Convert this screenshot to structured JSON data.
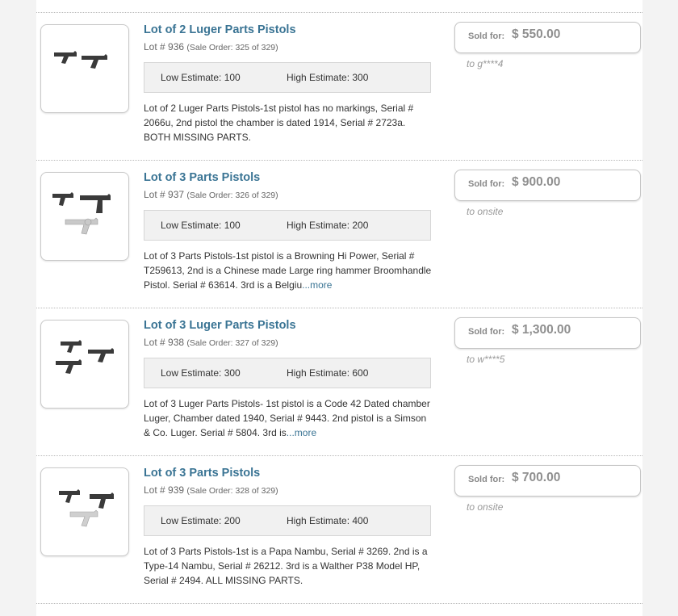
{
  "lots": [
    {
      "title": "Lot of 2 Luger Parts Pistols",
      "lot_number": "Lot # 936",
      "sale_order": "(Sale Order: 325 of 329)",
      "low_estimate": "Low Estimate: 100",
      "high_estimate": "High Estimate: 300",
      "description": "Lot of 2 Luger Parts Pistols-1st pistol has no markings, Serial # 2066u, 2nd pistol the chamber is dated 1914, Serial # 2723a. BOTH MISSING PARTS.",
      "more_link": "",
      "sold_label": "Sold for:",
      "sold_price": "$ 550.00",
      "buyer": "to g****4",
      "image_icon": "two-luger-pistols-image"
    },
    {
      "title": "Lot of 3 Parts Pistols",
      "lot_number": "Lot # 937",
      "sale_order": "(Sale Order: 326 of 329)",
      "low_estimate": "Low Estimate: 100",
      "high_estimate": "High Estimate: 200",
      "description": "Lot of 3 Parts Pistols-1st pistol is a Browning Hi Power, Serial # T259613, 2nd is a Chinese made Large ring hammer Broomhandle Pistol. Serial # 63614. 3rd is a Belgiu",
      "more_link": "...more",
      "sold_label": "Sold for:",
      "sold_price": "$ 900.00",
      "buyer": "to onsite",
      "image_icon": "three-pistols-image"
    },
    {
      "title": "Lot of 3 Luger Parts Pistols",
      "lot_number": "Lot # 938",
      "sale_order": "(Sale Order: 327 of 329)",
      "low_estimate": "Low Estimate: 300",
      "high_estimate": "High Estimate: 600",
      "description": "Lot of 3 Luger Parts Pistols- 1st pistol is a Code 42 Dated chamber Luger, Chamber dated 1940, Serial # 9443. 2nd pistol is a Simson & Co. Luger. Serial # 5804. 3rd is",
      "more_link": "...more",
      "sold_label": "Sold for:",
      "sold_price": "$ 1,300.00",
      "buyer": "to w****5",
      "image_icon": "three-luger-pistols-image"
    },
    {
      "title": "Lot of 3 Parts Pistols",
      "lot_number": "Lot # 939",
      "sale_order": "(Sale Order: 328 of 329)",
      "low_estimate": "Low Estimate: 200",
      "high_estimate": "High Estimate: 400",
      "description": "Lot of 3 Parts Pistols-1st is a Papa Nambu, Serial # 3269. 2nd is a Type-14 Nambu, Serial # 26212. 3rd is a Walther P38 Model HP, Serial # 2494. ALL MISSING PARTS.",
      "more_link": "",
      "sold_label": "Sold for:",
      "sold_price": "$ 700.00",
      "buyer": "to onsite",
      "image_icon": "three-pistols-image"
    }
  ],
  "colors": {
    "title_link": "#3a7494",
    "estimate_bg": "#f1f1f1",
    "sold_price": "#8f8f8f",
    "buyer_text": "#999999"
  }
}
